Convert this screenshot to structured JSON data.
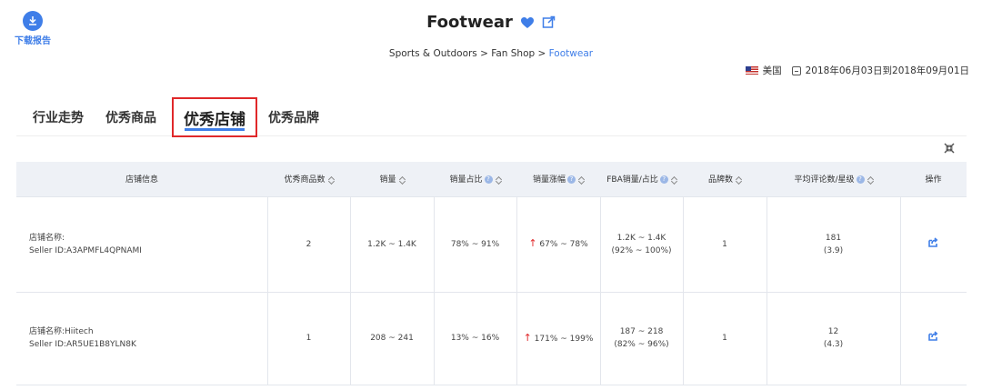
{
  "download": {
    "label": "下载报告",
    "icon": "download-icon"
  },
  "header": {
    "title": "Footwear",
    "breadcrumb": {
      "path": "Sports & Outdoors > Fan Shop > ",
      "current": "Footwear"
    }
  },
  "meta": {
    "country": "美国",
    "date_range": "2018年06月03日到2018年09月01日"
  },
  "tabs": [
    {
      "label": "行业走势"
    },
    {
      "label": "优秀商品"
    },
    {
      "label": "优秀店铺"
    },
    {
      "label": "优秀品牌"
    }
  ],
  "table": {
    "headers": [
      "店铺信息",
      "优秀商品数",
      "销量",
      "销量占比",
      "销量涨幅",
      "FBA销量/占比",
      "品牌数",
      "平均评论数/星级",
      "操作"
    ],
    "rows": [
      {
        "store_name": "店铺名称:",
        "seller_id": "Seller ID:A3APMFL4QPNAMI",
        "products": "2",
        "sales": "1.2K ~ 1.4K",
        "share": "78% ~ 91%",
        "growth": "67% ~ 78%",
        "fba_sales": "1.2K ~ 1.4K",
        "fba_share": "(92% ~ 100%)",
        "brands": "1",
        "reviews": "181",
        "rating": "(3.9)"
      },
      {
        "store_name": "店铺名称:Hiitech",
        "seller_id": "Seller ID:AR5UE1B8YLN8K",
        "products": "1",
        "sales": "208 ~ 241",
        "share": "13% ~ 16%",
        "growth": "171% ~ 199%",
        "fba_sales": "187 ~ 218",
        "fba_share": "(82% ~ 96%)",
        "brands": "1",
        "reviews": "12",
        "rating": "(4.3)"
      }
    ]
  },
  "colors": {
    "accent": "#3f7ee8",
    "highlight": "#e0282a",
    "header_bg": "#eef1f6"
  }
}
